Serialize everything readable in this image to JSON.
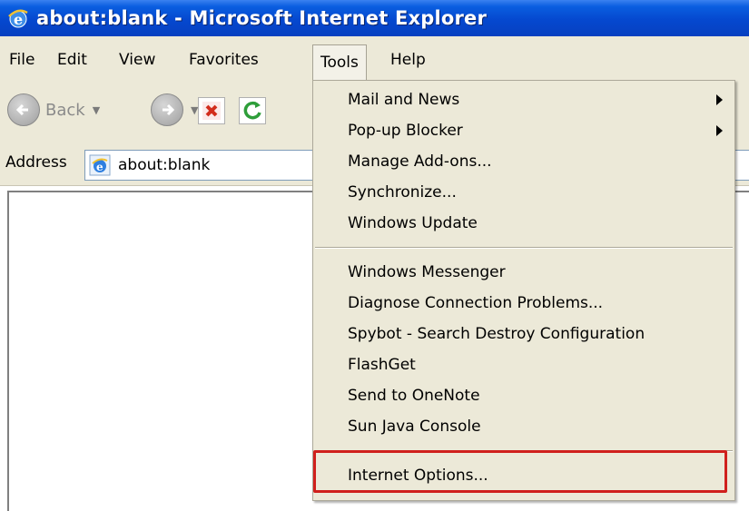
{
  "window": {
    "title": "about:blank - Microsoft Internet Explorer"
  },
  "menubar": {
    "items": [
      {
        "label": "File"
      },
      {
        "label": "Edit"
      },
      {
        "label": "View"
      },
      {
        "label": "Favorites"
      },
      {
        "label": "Tools"
      },
      {
        "label": "Help"
      }
    ],
    "active": "Tools"
  },
  "toolbar": {
    "back_label": "Back"
  },
  "addressbar": {
    "label": "Address",
    "value": "about:blank"
  },
  "tools_menu": {
    "groups": [
      [
        {
          "label": "Mail and News",
          "submenu": true
        },
        {
          "label": "Pop-up Blocker",
          "submenu": true
        },
        {
          "label": "Manage Add-ons..."
        },
        {
          "label": "Synchronize..."
        },
        {
          "label": "Windows Update"
        }
      ],
      [
        {
          "label": "Windows Messenger"
        },
        {
          "label": "Diagnose Connection Problems..."
        },
        {
          "label": "Spybot - Search  Destroy Configuration"
        },
        {
          "label": "FlashGet"
        },
        {
          "label": "Send to OneNote"
        },
        {
          "label": "Sun Java Console"
        }
      ],
      [
        {
          "label": "Internet Options..."
        }
      ]
    ]
  },
  "annotation": {
    "highlight_color": "#d0201d"
  }
}
